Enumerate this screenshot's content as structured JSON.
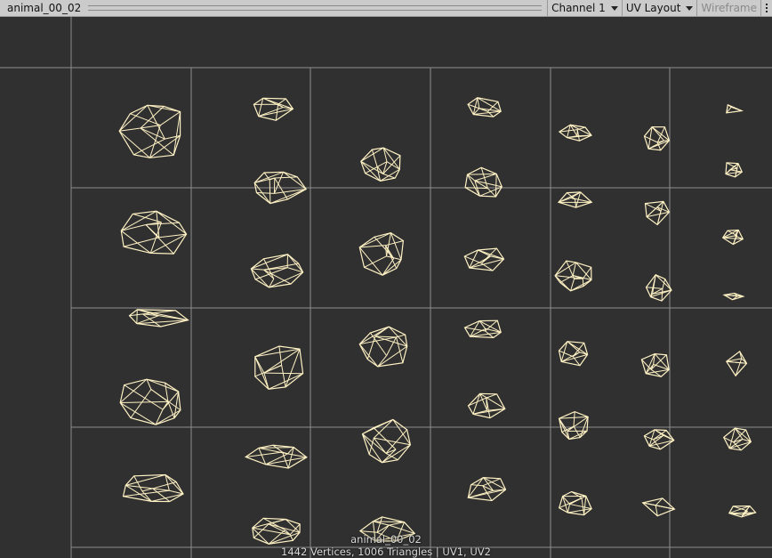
{
  "window": {
    "title": "animal_00_02"
  },
  "toolbar": {
    "channel_label": "Channel 1",
    "view_mode_label": "UV Layout",
    "wireframe_label": "Wireframe"
  },
  "overlay": {
    "mesh_name": "animal_00_02",
    "stats": "1442 Vertices, 1006 Triangles | UV1, UV2"
  },
  "colors": {
    "background": "#303030",
    "grid": "#8e8e8e",
    "wireframe": "#fff2c4",
    "toolbar": "#cbcbcb"
  }
}
